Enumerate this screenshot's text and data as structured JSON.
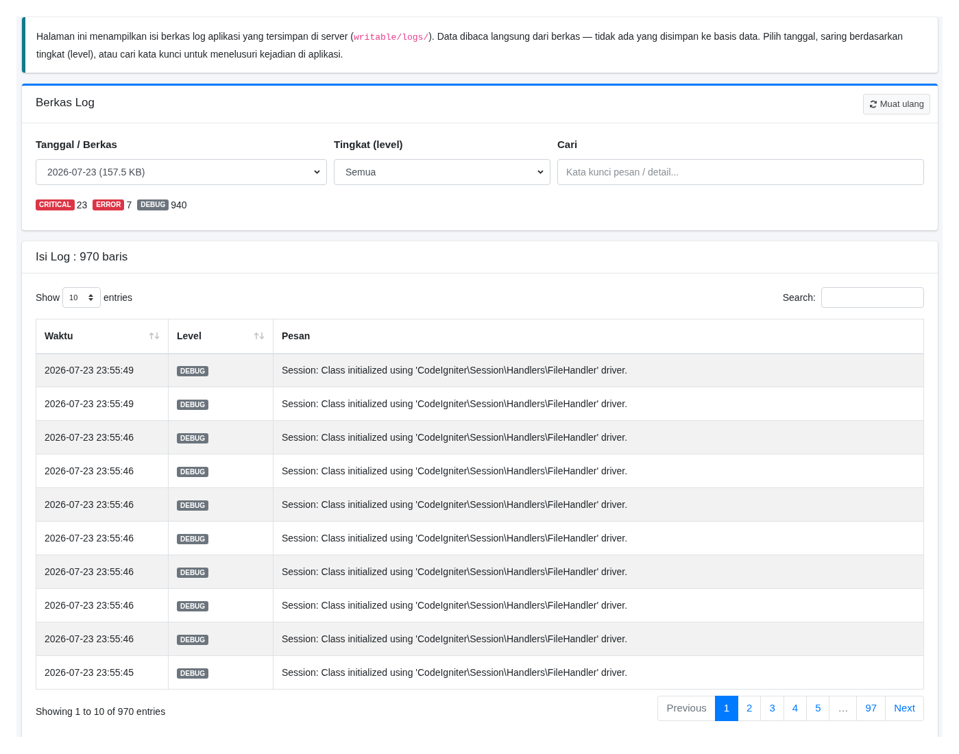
{
  "info_callout": {
    "segments": [
      {
        "kind": "text",
        "text": "Halaman ini menampilkan isi berkas log aplikasi yang tersimpan di server ("
      },
      {
        "kind": "code",
        "text": "writable/logs/"
      },
      {
        "kind": "text",
        "text": "). Data dibaca langsung dari berkas — tidak ada yang disimpan ke basis data. Pilih tanggal, saring berdasarkan tingkat (level), atau cari kata kunci untuk menelusuri kejadian di aplikasi."
      }
    ]
  },
  "log_file_card": {
    "title": "Berkas Log",
    "reload_button": "Muat ulang",
    "filters": [
      {
        "kind": "select",
        "label": "Tanggal / Berkas",
        "value": "2026-07-23 (157.5 KB)"
      },
      {
        "kind": "select",
        "label": "Tingkat (level)",
        "value": "Semua"
      },
      {
        "kind": "text",
        "label": "Cari",
        "placeholder": "Kata kunci pesan / detail..."
      }
    ],
    "level_counts": [
      {
        "level": "CRITICAL",
        "color": "#dc3545",
        "count": "23"
      },
      {
        "level": "ERROR",
        "color": "#dc3545",
        "count": "7"
      },
      {
        "level": "DEBUG",
        "color": "#6c757d",
        "count": "940"
      }
    ]
  },
  "log_content_card": {
    "title": "Isi Log : 970 baris",
    "show_label": "Show",
    "page_length": "10",
    "entries_label": "entries",
    "search_label": "Search:",
    "table": {
      "columns": [
        {
          "label": "Waktu",
          "sortable": true
        },
        {
          "label": "Level",
          "sortable": true
        },
        {
          "label": "Pesan",
          "sortable": false
        }
      ],
      "rows": [
        {
          "time": "2026-07-23 23:55:49",
          "level": "DEBUG",
          "color": "#6c757d",
          "message": "Session: Class initialized using 'CodeIgniter\\Session\\Handlers\\FileHandler' driver."
        },
        {
          "time": "2026-07-23 23:55:49",
          "level": "DEBUG",
          "color": "#6c757d",
          "message": "Session: Class initialized using 'CodeIgniter\\Session\\Handlers\\FileHandler' driver."
        },
        {
          "time": "2026-07-23 23:55:46",
          "level": "DEBUG",
          "color": "#6c757d",
          "message": "Session: Class initialized using 'CodeIgniter\\Session\\Handlers\\FileHandler' driver."
        },
        {
          "time": "2026-07-23 23:55:46",
          "level": "DEBUG",
          "color": "#6c757d",
          "message": "Session: Class initialized using 'CodeIgniter\\Session\\Handlers\\FileHandler' driver."
        },
        {
          "time": "2026-07-23 23:55:46",
          "level": "DEBUG",
          "color": "#6c757d",
          "message": "Session: Class initialized using 'CodeIgniter\\Session\\Handlers\\FileHandler' driver."
        },
        {
          "time": "2026-07-23 23:55:46",
          "level": "DEBUG",
          "color": "#6c757d",
          "message": "Session: Class initialized using 'CodeIgniter\\Session\\Handlers\\FileHandler' driver."
        },
        {
          "time": "2026-07-23 23:55:46",
          "level": "DEBUG",
          "color": "#6c757d",
          "message": "Session: Class initialized using 'CodeIgniter\\Session\\Handlers\\FileHandler' driver."
        },
        {
          "time": "2026-07-23 23:55:46",
          "level": "DEBUG",
          "color": "#6c757d",
          "message": "Session: Class initialized using 'CodeIgniter\\Session\\Handlers\\FileHandler' driver."
        },
        {
          "time": "2026-07-23 23:55:46",
          "level": "DEBUG",
          "color": "#6c757d",
          "message": "Session: Class initialized using 'CodeIgniter\\Session\\Handlers\\FileHandler' driver."
        },
        {
          "time": "2026-07-23 23:55:45",
          "level": "DEBUG",
          "color": "#6c757d",
          "message": "Session: Class initialized using 'CodeIgniter\\Session\\Handlers\\FileHandler' driver."
        }
      ]
    },
    "table_info": "Showing 1 to 10 of 970 entries",
    "pagination": [
      {
        "label": "Previous",
        "selected": false,
        "disabled": true
      },
      {
        "label": "1",
        "selected": true,
        "disabled": false
      },
      {
        "label": "2",
        "selected": false,
        "disabled": false
      },
      {
        "label": "3",
        "selected": false,
        "disabled": false
      },
      {
        "label": "4",
        "selected": false,
        "disabled": false
      },
      {
        "label": "5",
        "selected": false,
        "disabled": false
      },
      {
        "label": "…",
        "selected": false,
        "disabled": true
      },
      {
        "label": "97",
        "selected": false,
        "disabled": false
      },
      {
        "label": "Next",
        "selected": false,
        "disabled": false
      }
    ]
  }
}
